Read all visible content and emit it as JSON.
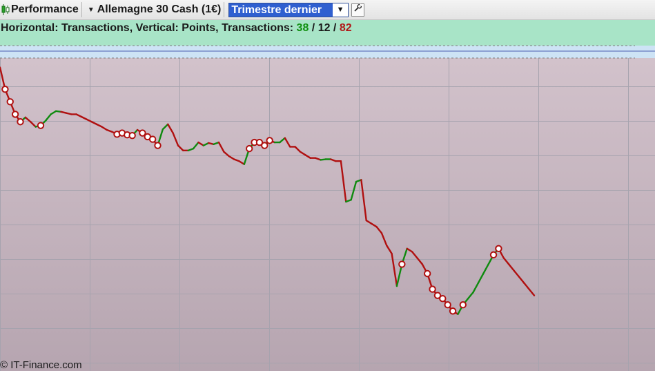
{
  "toolbar": {
    "performance_label": "Performance",
    "instrument_label": "Allemagne 30 Cash (1€)",
    "period_value": "Trimestre dernier",
    "icons": {
      "performance": "candlestick-icon",
      "instrument_dropdown": "caret-down-icon",
      "period_dropdown": "caret-down-icon",
      "settings": "wrench-icon"
    }
  },
  "info": {
    "prefix": "Horizontal: Transactions, Vertical: Points, Transactions: ",
    "positive": "38",
    "sep1": " / ",
    "neutral": "12",
    "sep2": " / ",
    "negative": "82"
  },
  "footer": {
    "copyright": "© IT-Finance.com"
  },
  "colors": {
    "positive": "#0f8a0f",
    "negative": "#b01010",
    "band": "#a8e4c7",
    "zero_band": "#cde3f5",
    "plot_bg_top": "#d4c4cd",
    "plot_bg_bottom": "#b6a5b0",
    "grid": "#a6a3ae",
    "zero_line": "#4a5eb0"
  },
  "chart_data": {
    "type": "line",
    "title": "",
    "xlabel": "",
    "ylabel": "",
    "grid": true,
    "legend": "none",
    "xlim": [
      0,
      132
    ],
    "ylim": [
      -450,
      10
    ],
    "y_scale": "linear",
    "series": [
      {
        "values": [
          -5,
          -40,
          -60,
          -80,
          -92,
          -85,
          -92,
          -100,
          -98,
          -90,
          -80,
          -75,
          -76,
          -78,
          -80,
          -80,
          -84,
          -88,
          -92,
          -96,
          -100,
          -105,
          -108,
          -112,
          -110,
          -113,
          -114,
          -105,
          -110,
          -116,
          -120,
          -130,
          -104,
          -96,
          -110,
          -130,
          -138,
          -138,
          -135,
          -125,
          -130,
          -126,
          -128,
          -125,
          -140,
          -147,
          -152,
          -155,
          -160,
          -135,
          -125,
          -125,
          -130,
          -122,
          -125,
          -125,
          -118,
          -132,
          -132,
          -140,
          -145,
          -150,
          -150,
          -153,
          -152,
          -152,
          -155,
          -155,
          -220,
          -217,
          -188,
          -185,
          -250,
          -255,
          -260,
          -270,
          -290,
          -303,
          -355,
          -320,
          -295,
          -300,
          -310,
          -320,
          -335,
          -360,
          -370,
          -375,
          -385,
          -395,
          -400,
          -385,
          -375,
          -365,
          -350,
          -335,
          -320,
          -305,
          -295,
          -310,
          -320,
          -330,
          -340,
          -350,
          -360,
          -370
        ],
        "outcomes": [
          "n",
          "l",
          "l",
          "l",
          "l",
          "w",
          "l",
          "l",
          "w",
          "w",
          "w",
          "w",
          "w",
          "l",
          "l",
          "l",
          "l",
          "l",
          "l",
          "l",
          "l",
          "l",
          "l",
          "l",
          "w",
          "l",
          "l",
          "w",
          "l",
          "l",
          "l",
          "l",
          "w",
          "w",
          "l",
          "l",
          "l",
          "l",
          "w",
          "w",
          "l",
          "w",
          "l",
          "w",
          "l",
          "l",
          "l",
          "l",
          "l",
          "w",
          "w",
          "w",
          "l",
          "w",
          "l",
          "w",
          "w",
          "l",
          "l",
          "l",
          "l",
          "l",
          "l",
          "l",
          "w",
          "w",
          "l",
          "l",
          "l",
          "w",
          "w",
          "w",
          "l",
          "l",
          "l",
          "l",
          "l",
          "l",
          "l",
          "w",
          "w",
          "l",
          "l",
          "l",
          "l",
          "l",
          "l",
          "l",
          "l",
          "l",
          "l",
          "w",
          "w",
          "w",
          "w",
          "w",
          "w",
          "w",
          "w",
          "l",
          "l",
          "l",
          "l",
          "l",
          "l",
          "l"
        ],
        "markers": [
          1,
          2,
          3,
          4,
          8,
          23,
          24,
          25,
          26,
          28,
          29,
          30,
          31,
          49,
          50,
          51,
          52,
          53,
          79,
          84,
          85,
          86,
          87,
          88,
          89,
          91,
          97,
          98
        ]
      }
    ]
  }
}
